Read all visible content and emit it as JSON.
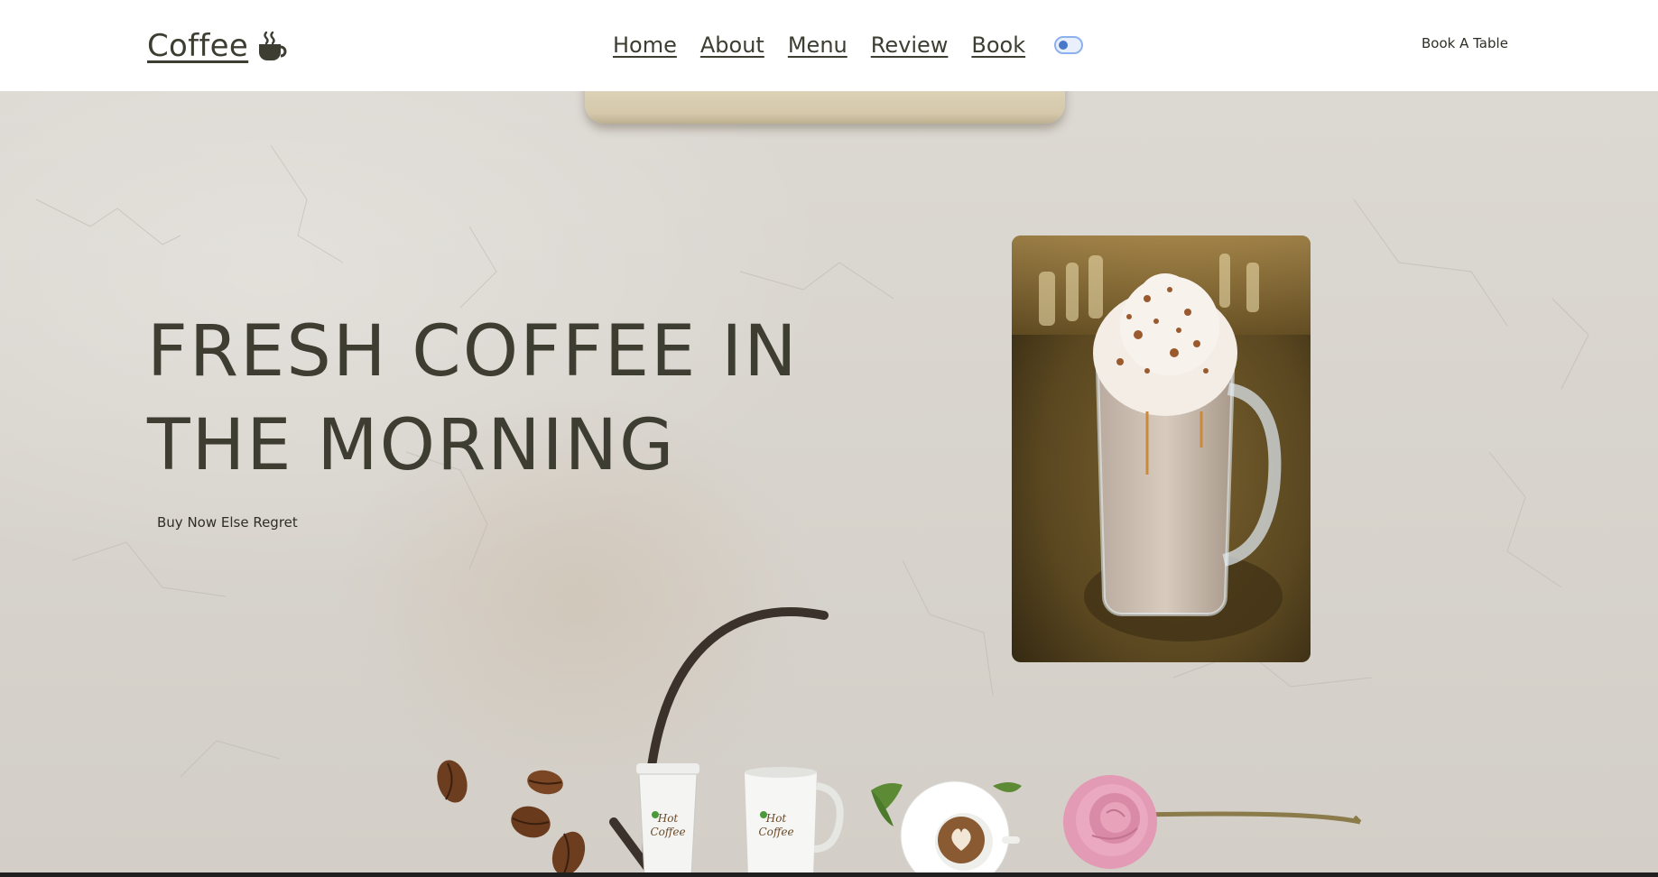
{
  "header": {
    "logo_text": "Coffee",
    "logo_icon": "coffee-cup-icon",
    "nav": [
      "Home",
      "About",
      "Menu",
      "Review",
      "Book"
    ],
    "theme_toggle_icon": "toggle-switch-icon",
    "cta_label": "Book A Table"
  },
  "hero": {
    "headline_line1": "FRESH COFFEE IN",
    "headline_line2": "THE MORNING",
    "sub_label": "Buy Now Else Regret",
    "cup_brand_text": "Hot Coffee",
    "image_description": "glass mug of coffee with whipped cream"
  },
  "colors": {
    "text_dark": "#3d3d32",
    "toggle_blue": "#8db1ee",
    "background_stone": "#d8d4cd"
  }
}
